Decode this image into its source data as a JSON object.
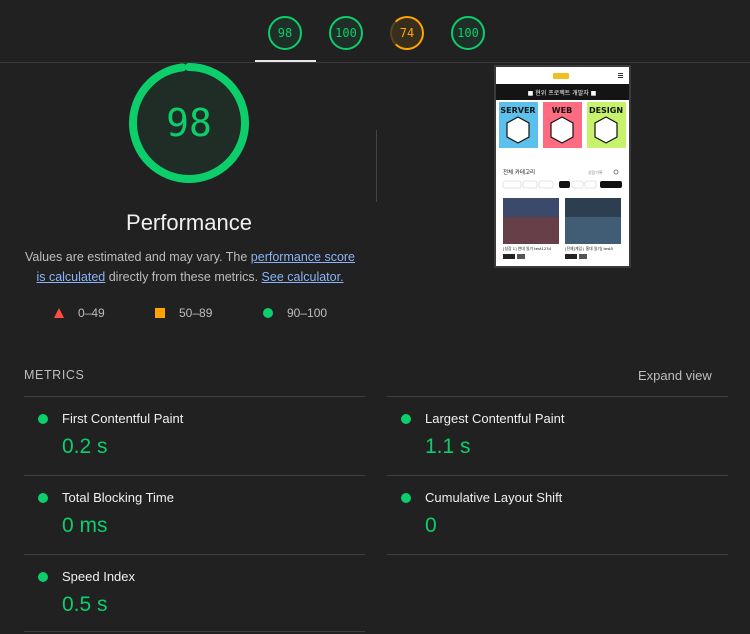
{
  "tabs": [
    {
      "score": "98",
      "status": "pass"
    },
    {
      "score": "100",
      "status": "pass"
    },
    {
      "score": "74",
      "status": "average"
    },
    {
      "score": "100",
      "status": "pass"
    }
  ],
  "gauge": {
    "score": "98",
    "title": "Performance"
  },
  "description": {
    "prefix": "Values are estimated and may vary. The ",
    "link1": "performance score is calculated",
    "middle": " directly from these metrics. ",
    "link2": "See calculator."
  },
  "legend": {
    "fail": "0–49",
    "average": "50–89",
    "pass": "90–100"
  },
  "thumbnail": {
    "banner": "■ 현위 프로젝트 개발자 ■",
    "cards": [
      "SERVER",
      "WEB",
      "DESIGN"
    ],
    "category_title": "전체 카테고리",
    "category_link": "성장기록",
    "chips": [
      "최신순",
      "추천순",
      "인기순",
      "전체",
      "백엔드",
      "웹",
      "모바일",
      "디자인"
    ],
    "posts": [
      "[성장 1] 연대 일기 test1234",
      "[전체]게임 | 홈대 일기] test5"
    ]
  },
  "metrics": {
    "header": "METRICS",
    "expand": "Expand view",
    "items": [
      {
        "label": "First Contentful Paint",
        "value": "0.2 s"
      },
      {
        "label": "Largest Contentful Paint",
        "value": "1.1 s"
      },
      {
        "label": "Total Blocking Time",
        "value": "0 ms"
      },
      {
        "label": "Cumulative Layout Shift",
        "value": "0"
      },
      {
        "label": "Speed Index",
        "value": "0.5 s"
      }
    ]
  },
  "colors": {
    "pass": "#0cce6b",
    "average": "#ffa400",
    "fail": "#ff4e42",
    "background": "#212121"
  }
}
